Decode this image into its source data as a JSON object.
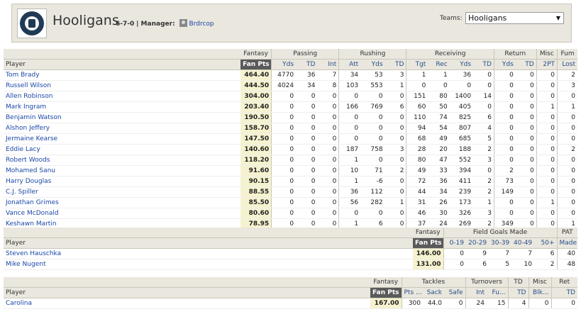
{
  "header": {
    "team_name": "Hooligans",
    "record": "6-7-0",
    "manager_label": "| Manager:",
    "manager_name": "Brdrcop",
    "teams_label": "Teams:",
    "teams_selected": "Hooligans"
  },
  "offense": {
    "group_headers": [
      "Fantasy",
      "Passing",
      "Rushing",
      "Receiving",
      "Return",
      "Misc",
      "Fum"
    ],
    "player_header": "Player",
    "columns": [
      "Fan Pts",
      "Yds",
      "TD",
      "Int",
      "Att",
      "Yds",
      "TD",
      "Tgt",
      "Rec",
      "Yds",
      "TD",
      "Yds",
      "TD",
      "2PT",
      "Lost"
    ],
    "rows": [
      {
        "name": "Tom Brady",
        "vals": [
          "464.40",
          "4770",
          "36",
          "7",
          "34",
          "53",
          "3",
          "1",
          "1",
          "36",
          "0",
          "0",
          "0",
          "0",
          "2"
        ]
      },
      {
        "name": "Russell Wilson",
        "vals": [
          "444.50",
          "4024",
          "34",
          "8",
          "103",
          "553",
          "1",
          "0",
          "0",
          "0",
          "0",
          "0",
          "0",
          "0",
          "3"
        ]
      },
      {
        "name": "Allen Robinson",
        "vals": [
          "304.00",
          "0",
          "0",
          "0",
          "0",
          "0",
          "0",
          "151",
          "80",
          "1400",
          "14",
          "0",
          "0",
          "0",
          "0"
        ]
      },
      {
        "name": "Mark Ingram",
        "vals": [
          "203.40",
          "0",
          "0",
          "0",
          "166",
          "769",
          "6",
          "60",
          "50",
          "405",
          "0",
          "0",
          "0",
          "1",
          "1"
        ]
      },
      {
        "name": "Benjamin Watson",
        "vals": [
          "190.50",
          "0",
          "0",
          "0",
          "0",
          "0",
          "0",
          "110",
          "74",
          "825",
          "6",
          "0",
          "0",
          "0",
          "0"
        ]
      },
      {
        "name": "Alshon Jeffery",
        "vals": [
          "158.70",
          "0",
          "0",
          "0",
          "0",
          "0",
          "0",
          "94",
          "54",
          "807",
          "4",
          "0",
          "0",
          "0",
          "0"
        ]
      },
      {
        "name": "Jermaine Kearse",
        "vals": [
          "147.50",
          "0",
          "0",
          "0",
          "0",
          "0",
          "0",
          "68",
          "49",
          "685",
          "5",
          "0",
          "0",
          "0",
          "0"
        ]
      },
      {
        "name": "Eddie Lacy",
        "vals": [
          "140.60",
          "0",
          "0",
          "0",
          "187",
          "758",
          "3",
          "28",
          "20",
          "188",
          "2",
          "0",
          "0",
          "0",
          "2"
        ]
      },
      {
        "name": "Robert Woods",
        "vals": [
          "118.20",
          "0",
          "0",
          "0",
          "1",
          "0",
          "0",
          "80",
          "47",
          "552",
          "3",
          "0",
          "0",
          "0",
          "0"
        ]
      },
      {
        "name": "Mohamed Sanu",
        "vals": [
          "91.60",
          "0",
          "0",
          "0",
          "10",
          "71",
          "2",
          "49",
          "33",
          "394",
          "0",
          "2",
          "0",
          "0",
          "0"
        ]
      },
      {
        "name": "Harry Douglas",
        "vals": [
          "90.15",
          "0",
          "0",
          "0",
          "1",
          "-6",
          "0",
          "72",
          "36",
          "411",
          "2",
          "73",
          "0",
          "0",
          "0"
        ]
      },
      {
        "name": "C.J. Spiller",
        "vals": [
          "88.55",
          "0",
          "0",
          "0",
          "36",
          "112",
          "0",
          "44",
          "34",
          "239",
          "2",
          "149",
          "0",
          "0",
          "0"
        ]
      },
      {
        "name": "Jonathan Grimes",
        "vals": [
          "85.50",
          "0",
          "0",
          "0",
          "56",
          "282",
          "1",
          "31",
          "26",
          "173",
          "1",
          "0",
          "0",
          "1",
          "0"
        ]
      },
      {
        "name": "Vance McDonald",
        "vals": [
          "80.60",
          "0",
          "0",
          "0",
          "0",
          "0",
          "0",
          "46",
          "30",
          "326",
          "3",
          "0",
          "0",
          "0",
          "0"
        ]
      },
      {
        "name": "Keshawn Martin",
        "vals": [
          "78.95",
          "0",
          "0",
          "0",
          "1",
          "6",
          "0",
          "37",
          "24",
          "269",
          "2",
          "349",
          "0",
          "0",
          "1"
        ]
      }
    ]
  },
  "kickers": {
    "group_headers": [
      "Fantasy",
      "Field Goals Made",
      "PAT"
    ],
    "player_header": "Player",
    "columns": [
      "Fan Pts",
      "0-19",
      "20-29",
      "30-39",
      "40-49",
      "50+",
      "Made"
    ],
    "rows": [
      {
        "name": "Steven Hauschka",
        "vals": [
          "146.00",
          "0",
          "9",
          "7",
          "7",
          "6",
          "40"
        ]
      },
      {
        "name": "Mike Nugent",
        "vals": [
          "131.00",
          "0",
          "6",
          "5",
          "10",
          "2",
          "48"
        ]
      }
    ]
  },
  "defense": {
    "group_headers": [
      "Fantasy",
      "Tackles",
      "Turnovers",
      "TD",
      "Misc",
      "Ret"
    ],
    "player_header": "Player",
    "columns": [
      "Fan Pts",
      "Pts ...",
      "Sack",
      "Safe",
      "Int",
      "Fu...",
      "TD",
      "Blk...",
      "TD"
    ],
    "rows": [
      {
        "name": "Carolina",
        "vals": [
          "167.00",
          "300",
          "44.0",
          "0",
          "24",
          "15",
          "4",
          "0",
          "0"
        ]
      }
    ]
  }
}
